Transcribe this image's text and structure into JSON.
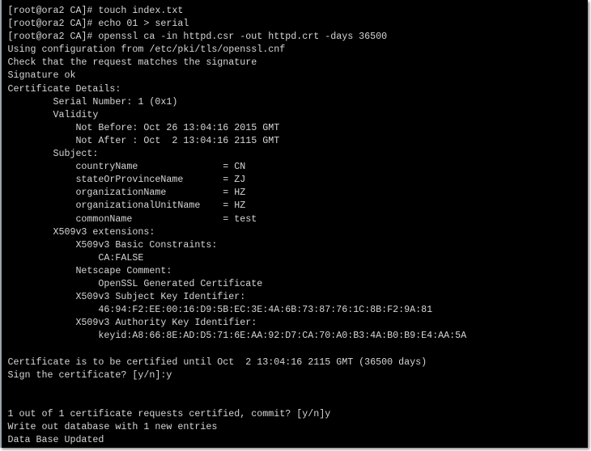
{
  "terminal": {
    "background": "#000000",
    "foreground": "#d6d6d6",
    "lines": [
      "[root@ora2 CA]# touch index.txt",
      "[root@ora2 CA]# echo 01 > serial",
      "[root@ora2 CA]# openssl ca -in httpd.csr -out httpd.crt -days 36500",
      "Using configuration from /etc/pki/tls/openssl.cnf",
      "Check that the request matches the signature",
      "Signature ok",
      "Certificate Details:",
      "        Serial Number: 1 (0x1)",
      "        Validity",
      "            Not Before: Oct 26 13:04:16 2015 GMT",
      "            Not After : Oct  2 13:04:16 2115 GMT",
      "        Subject:",
      "            countryName               = CN",
      "            stateOrProvinceName       = ZJ",
      "            organizationName          = HZ",
      "            organizationalUnitName    = HZ",
      "            commonName                = test",
      "        X509v3 extensions:",
      "            X509v3 Basic Constraints:",
      "                CA:FALSE",
      "            Netscape Comment:",
      "                OpenSSL Generated Certificate",
      "            X509v3 Subject Key Identifier:",
      "                46:94:F2:EE:00:16:D9:5B:EC:3E:4A:6B:73:87:76:1C:8B:F2:9A:81",
      "            X509v3 Authority Key Identifier:",
      "                keyid:A8:66:8E:AD:D5:71:6E:AA:92:D7:CA:70:A0:B3:4A:B0:B9:E4:AA:5A",
      "",
      "Certificate is to be certified until Oct  2 13:04:16 2115 GMT (36500 days)",
      "Sign the certificate? [y/n]:y",
      "",
      "",
      "1 out of 1 certificate requests certified, commit? [y/n]y",
      "Write out database with 1 new entries",
      "Data Base Updated"
    ]
  }
}
